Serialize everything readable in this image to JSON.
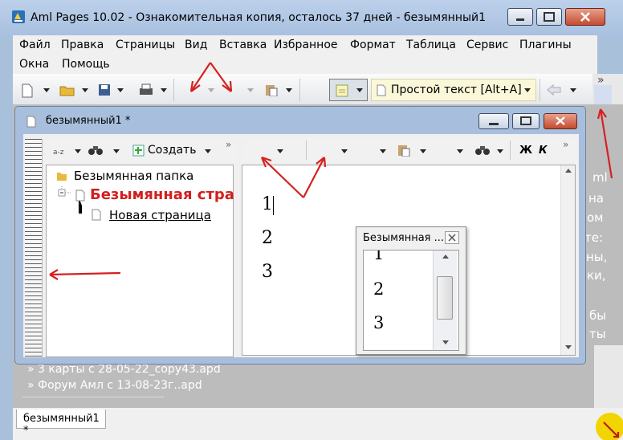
{
  "window": {
    "title": "Aml Pages 10.02 - Ознакомительная копия, осталось 37 дней - безымянный1"
  },
  "menu": [
    "Файл",
    "Правка",
    "Страницы",
    "Вид",
    "Вставка",
    "Избранное",
    "Формат",
    "Таблица",
    "Сервис",
    "Плагины",
    "Окна",
    "Помощь"
  ],
  "toolbar": {
    "style_label": "Простой текст [Alt+A]",
    "more": "»"
  },
  "document_window": {
    "title": "безымянный1 *"
  },
  "tree_toolbar": {
    "create_label": "Создать",
    "more": "»"
  },
  "tree": {
    "folder": "Безымянная папка",
    "page1": "Безымянная стра",
    "page2": "Новая страница"
  },
  "editor_toolbar": {
    "bold": "Ж",
    "italic": "К",
    "more": "»"
  },
  "editor": {
    "lines": [
      "1",
      "2",
      "3"
    ]
  },
  "popup": {
    "title": "Безымянная ...",
    "lines": [
      "1",
      "2",
      "3"
    ]
  },
  "background": {
    "right_fragments": [
      "ml",
      "на",
      "ом",
      "те:",
      "ны,",
      "ки,",
      "бы",
      "ты"
    ],
    "links": [
      "» 3 карты с 28-05-22_copy43.apd",
      "» Форум Амл с 13-08-23г..apd"
    ]
  },
  "status": {
    "tab_label": "безымянный1 *"
  },
  "colors": {
    "annotation": "#d62020",
    "title_active": "#a8c0df"
  }
}
